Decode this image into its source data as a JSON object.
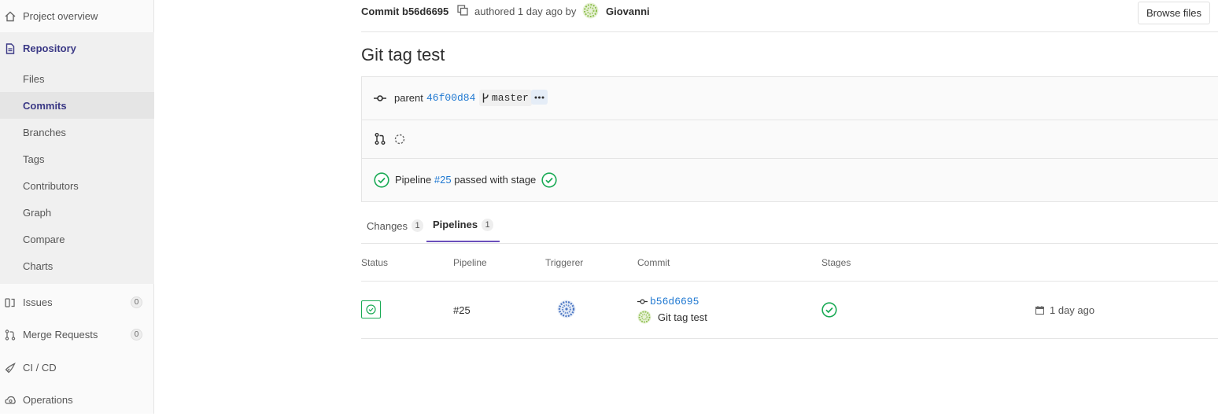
{
  "sidebar": {
    "project_overview": "Project overview",
    "repository": "Repository",
    "sub_items": [
      "Files",
      "Commits",
      "Branches",
      "Tags",
      "Contributors",
      "Graph",
      "Compare",
      "Charts"
    ],
    "issues": {
      "label": "Issues",
      "count": "0"
    },
    "merge_requests": {
      "label": "Merge Requests",
      "count": "0"
    },
    "cicd": "CI / CD",
    "operations": "Operations"
  },
  "header": {
    "commit_label": "Commit b56d6695",
    "authored": "authored 1 day ago by",
    "author": "Giovanni",
    "browse_files": "Browse files"
  },
  "commit": {
    "title": "Git tag test",
    "parent_label": "parent",
    "parent_sha": "46f00d84",
    "branch": "master",
    "pipeline_prefix": "Pipeline",
    "pipeline_id": "#25",
    "pipeline_suffix": "passed with stage"
  },
  "tabs": [
    {
      "label": "Changes",
      "count": "1"
    },
    {
      "label": "Pipelines",
      "count": "1"
    }
  ],
  "table": {
    "headers": [
      "Status",
      "Pipeline",
      "Triggerer",
      "Commit",
      "Stages"
    ],
    "row": {
      "pipeline": "#25",
      "commit_sha": "b56d6695",
      "commit_title": "Git tag test",
      "time": "1 day ago"
    }
  },
  "colors": {
    "success": "#1aaa55",
    "link": "#1f78d1",
    "active_nav": "#3a3885",
    "tab_underline": "#6b4fbb"
  }
}
